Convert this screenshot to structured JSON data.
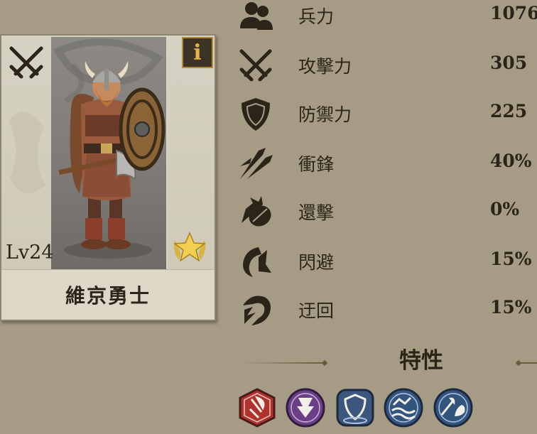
{
  "unit": {
    "level": "Lv24",
    "name": "維京勇士",
    "info_label": "i",
    "type_icon": "crossed-swords-icon",
    "rank_icon": "gold-star-laurel-icon"
  },
  "stats": [
    {
      "icon": "troops-icon",
      "label": "兵力",
      "value": "1076"
    },
    {
      "icon": "crossed-swords-icon",
      "label": "攻擊力",
      "value": "305"
    },
    {
      "icon": "shield-icon",
      "label": "防禦力",
      "value": "225"
    },
    {
      "icon": "charge-arrows-icon",
      "label": "衝鋒",
      "value": "40%"
    },
    {
      "icon": "counterattack-icon",
      "label": "還擊",
      "value": "0%"
    },
    {
      "icon": "dodge-icon",
      "label": "閃避",
      "value": "15%"
    },
    {
      "icon": "flank-icon",
      "label": "迂回",
      "value": "15%"
    }
  ],
  "traits": {
    "title": "特性",
    "items": [
      {
        "icon": "axe-berserker-trait-icon",
        "color": "#b1312c"
      },
      {
        "icon": "downward-strike-trait-icon",
        "color": "#6a3f86"
      },
      {
        "icon": "shield-aura-trait-icon",
        "color": "#3b577e"
      },
      {
        "icon": "water-waves-trait-icon",
        "color": "#33547d"
      },
      {
        "icon": "axe-vs-cavalry-trait-icon",
        "color": "#33547d"
      }
    ]
  }
}
